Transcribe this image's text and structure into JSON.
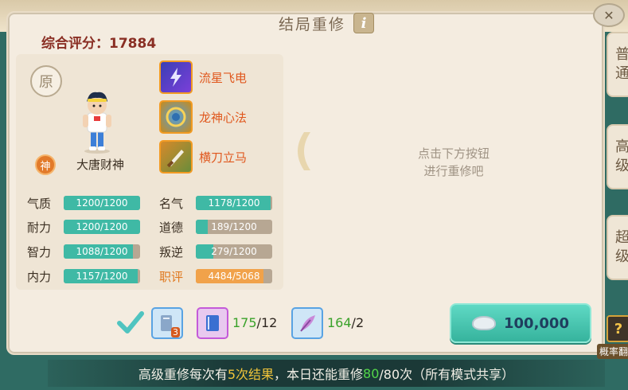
{
  "title": "结局重修",
  "info_icon": "i",
  "score": {
    "label": "综合评分：",
    "value": "17884"
  },
  "character": {
    "origin_badge": "原",
    "god_badge": "神",
    "name": "大唐财神"
  },
  "skills": [
    {
      "name": "流星飞电",
      "icon": "lightning-skill-icon"
    },
    {
      "name": "龙神心法",
      "icon": "dragon-skill-icon"
    },
    {
      "name": "横刀立马",
      "icon": "blade-skill-icon"
    }
  ],
  "stats_left": [
    {
      "label": "气质",
      "text": "1200/1200",
      "fraction": 1.0
    },
    {
      "label": "耐力",
      "text": "1200/1200",
      "fraction": 1.0
    },
    {
      "label": "智力",
      "text": "1088/1200",
      "fraction": 0.9067
    },
    {
      "label": "内力",
      "text": "1157/1200",
      "fraction": 0.9642
    }
  ],
  "stats_right": [
    {
      "label": "名气",
      "text": "1178/1200",
      "fraction": 0.9817,
      "fill": "teal"
    },
    {
      "label": "道德",
      "text": "189/1200",
      "fraction": 0.1575,
      "fill": "teal"
    },
    {
      "label": "叛逆",
      "text": "279/1200",
      "fraction": 0.2325,
      "fill": "teal"
    },
    {
      "label": "职评",
      "text": "4484/5068",
      "fraction": 0.8848,
      "fill": "orange"
    }
  ],
  "hint": {
    "line1": "点击下方按钮",
    "line2": "进行重修吧"
  },
  "side_tabs": [
    {
      "line1": "普",
      "line2": "通"
    },
    {
      "line1": "高",
      "line2": "级"
    },
    {
      "line1": "超",
      "line2": "级"
    }
  ],
  "items": {
    "item1_badge": "3",
    "item2_count": "175",
    "item2_total": "/12",
    "item3_count": "164",
    "item3_total": "/2"
  },
  "buy": {
    "price": "100,000"
  },
  "probability": {
    "label": "概率翻"
  },
  "footer": {
    "part1": "高级重修每次有",
    "highlight1": "5次结果",
    "part2": "，本日还能重修",
    "highlight2": "80",
    "part3": "/80次（所有模式共享）"
  },
  "colors": {
    "accent_teal": "#3fb9a5",
    "accent_orange": "#f1a24a",
    "score_red": "#8a2f24",
    "skill_orange": "#e0581e"
  }
}
